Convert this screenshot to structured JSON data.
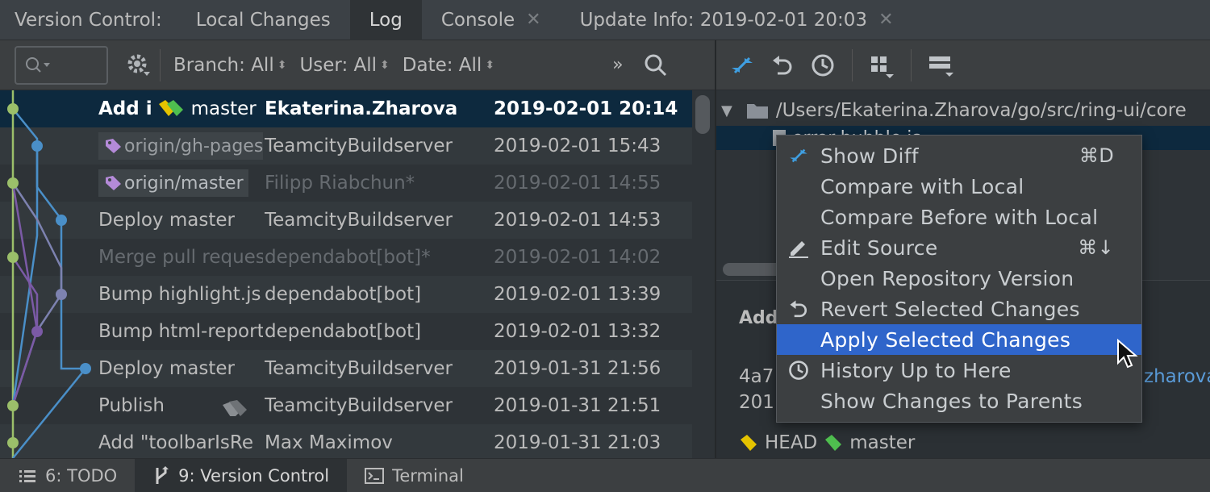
{
  "tabs": {
    "prefix": "Version Control:",
    "items": [
      {
        "label": "Local Changes",
        "closable": false,
        "active": false
      },
      {
        "label": "Log",
        "closable": false,
        "active": true
      },
      {
        "label": "Console",
        "closable": true,
        "active": false
      },
      {
        "label": "Update Info: 2019-02-01 20:03",
        "closable": true,
        "active": false
      }
    ],
    "close_glyph": "✕"
  },
  "toolbar": {
    "branch": "Branch: All",
    "user": "User: All",
    "date": "Date: All",
    "more": "»"
  },
  "log_rows": [
    {
      "msg": "Add i",
      "tag": "master",
      "author": "Ekaterina.Zharova",
      "date": "2019-02-01 20:14"
    },
    {
      "msg": "",
      "tag": "origin/gh-pages",
      "author": "TeamcityBuildserver",
      "date": "2019-02-01 15:43"
    },
    {
      "msg": "",
      "tag": "origin/master",
      "author": "Filipp Riabchun*",
      "date": "2019-02-01 14:55"
    },
    {
      "msg": "Deploy master",
      "tag": "",
      "author": "TeamcityBuildserver",
      "date": "2019-02-01 14:53"
    },
    {
      "msg": "Merge pull request",
      "tag": "",
      "author": "dependabot[bot]*",
      "date": "2019-02-01 14:02"
    },
    {
      "msg": "Bump highlight.js",
      "tag": "",
      "author": "dependabot[bot]",
      "date": "2019-02-01 13:39"
    },
    {
      "msg": "Bump html-report",
      "tag": "",
      "author": "dependabot[bot]",
      "date": "2019-02-01 13:32"
    },
    {
      "msg": "Deploy master",
      "tag": "",
      "author": "TeamcityBuildserver",
      "date": "2019-01-31 21:56"
    },
    {
      "msg": "Publish",
      "tag": "",
      "author": "TeamcityBuildserver",
      "date": "2019-01-31 21:51"
    },
    {
      "msg": "Add \"toolbarIsRe",
      "tag": "",
      "author": "Max Maximov",
      "date": "2019-01-31 21:03"
    }
  ],
  "tree": {
    "root": "/Users/Ekaterina.Zharova/go/src/ring-ui/core",
    "file": "error-bubble.js"
  },
  "details": {
    "title": "Add",
    "hash": "4a7",
    "date_prefix": "201",
    "link": "zharova",
    "refs": [
      "HEAD",
      "master"
    ]
  },
  "context_menu": [
    {
      "label": "Show Diff",
      "shortcut": "⌘D",
      "icon": "diff-icon"
    },
    {
      "label": "Compare with Local",
      "shortcut": "",
      "icon": ""
    },
    {
      "label": "Compare Before with Local",
      "shortcut": "",
      "icon": ""
    },
    {
      "label": "Edit Source",
      "shortcut": "⌘↓",
      "icon": "pencil-icon"
    },
    {
      "label": "Open Repository Version",
      "shortcut": "",
      "icon": ""
    },
    {
      "label": "Revert Selected Changes",
      "shortcut": "",
      "icon": "revert-icon"
    },
    {
      "label": "Apply Selected Changes",
      "shortcut": "",
      "icon": "",
      "highlighted": true
    },
    {
      "label": "History Up to Here",
      "shortcut": "",
      "icon": "clock-icon"
    },
    {
      "label": "Show Changes to Parents",
      "shortcut": "",
      "icon": ""
    }
  ],
  "statusbar": [
    {
      "label": "6: TODO",
      "icon": "list-icon",
      "active": false
    },
    {
      "label": "9: Version Control",
      "icon": "branch-icon",
      "active": true
    },
    {
      "label": "Terminal",
      "icon": "terminal-icon",
      "active": false
    }
  ],
  "colors": {
    "accent": "#2f65ca",
    "selection": "#0d293e",
    "tag_yellow": "#e5c300",
    "tag_green": "#4fbf4f",
    "tag_purple": "#b48ad8",
    "graph_green": "#9bbf6a",
    "graph_blue": "#4a8fc8",
    "graph_purple": "#7b5aa6",
    "graph_lavender": "#7d82b0"
  }
}
